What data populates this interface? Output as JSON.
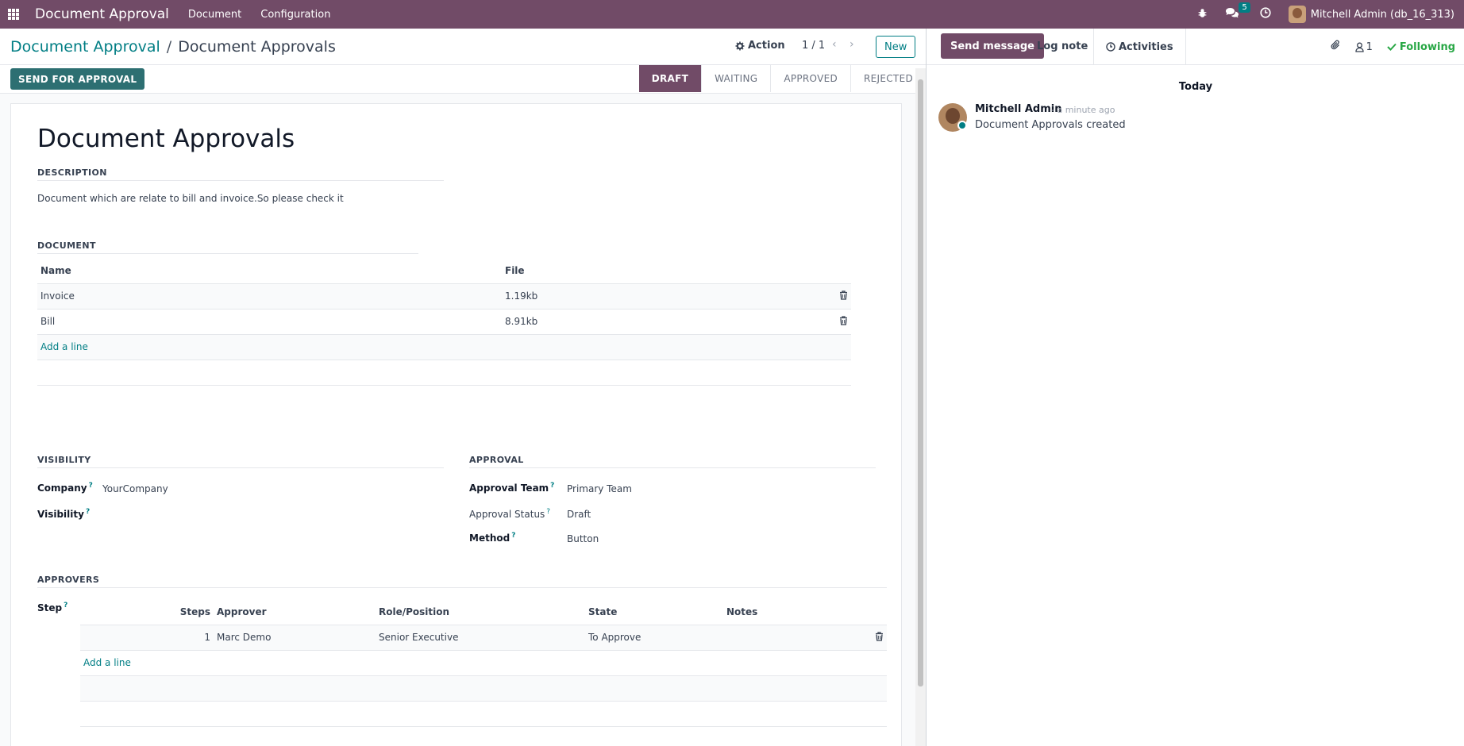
{
  "navbar": {
    "app_name": "Document Approval",
    "menu": [
      "Document",
      "Configuration"
    ],
    "message_count": "5",
    "user": "Mitchell Admin (db_16_313)"
  },
  "breadcrumb": {
    "parent": "Document Approval",
    "separator": "/",
    "current": "Document Approvals"
  },
  "control": {
    "action_label": "Action",
    "pager": "1 / 1",
    "new_label": "New"
  },
  "status": {
    "button_label": "SEND FOR APPROVAL",
    "stages": [
      "DRAFT",
      "WAITING",
      "APPROVED",
      "REJECTED"
    ],
    "active_stage": "DRAFT"
  },
  "form": {
    "title": "Document Approvals",
    "description_section": "DESCRIPTION",
    "description": "Document which are relate to bill and invoice.So please check it",
    "document_section": "DOCUMENT",
    "document_columns": [
      "Name",
      "File"
    ],
    "documents": [
      {
        "name": "Invoice",
        "file": "1.19kb"
      },
      {
        "name": "Bill",
        "file": "8.91kb"
      }
    ],
    "add_line": "Add a line",
    "visibility_section": "VISIBILITY",
    "company_label": "Company",
    "company_value": "YourCompany",
    "visibility_label": "Visibility",
    "approval_section": "APPROVAL",
    "approval_team_label": "Approval Team",
    "approval_team_value": "Primary Team",
    "approval_status_label": "Approval Status",
    "approval_status_value": "Draft",
    "method_label": "Method",
    "method_value": "Button",
    "approvers_section": "APPROVERS",
    "step_label": "Step",
    "approver_columns": [
      "Steps",
      "Approver",
      "Role/Position",
      "State",
      "Notes"
    ],
    "approvers": [
      {
        "steps": "1",
        "approver": "Marc Demo",
        "role": "Senior Executive",
        "state": "To Approve",
        "notes": ""
      }
    ],
    "help_mark": "?"
  },
  "chatter": {
    "send_message": "Send message",
    "log_note": "Log note",
    "activities": "Activities",
    "followers_count": "1",
    "following": "Following",
    "date_separator": "Today",
    "messages": [
      {
        "author": "Mitchell Admin",
        "time": "- a minute ago",
        "body": "Document Approvals created"
      }
    ]
  },
  "colors": {
    "brand": "#714b67",
    "accent": "#017e84",
    "primary_button": "#2d6f72",
    "following": "#28a745"
  }
}
